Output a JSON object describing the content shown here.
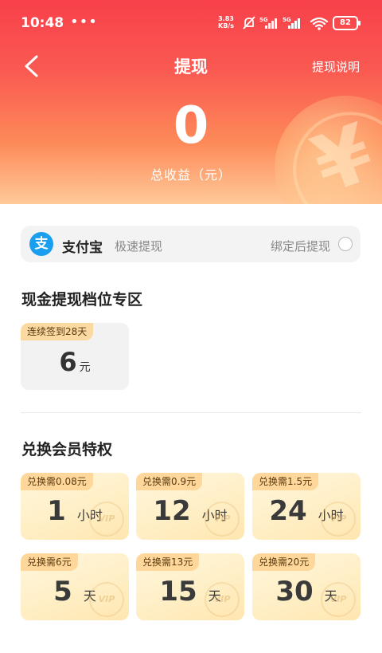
{
  "status_bar": {
    "time": "10:48",
    "more": "•••",
    "net_speed_value": "3.83",
    "net_speed_unit": "KB/s",
    "signal1_label": "5G",
    "signal2_label": "5G",
    "battery": "82"
  },
  "nav": {
    "title": "提现",
    "right_link": "提现说明"
  },
  "earnings": {
    "amount": "0",
    "label": "总收益（元）"
  },
  "alipay": {
    "logo_char": "支",
    "name": "支付宝",
    "subtitle": "极速提现",
    "bind_text": "绑定后提现"
  },
  "cash_section": {
    "title": "现金提现档位专区",
    "options": [
      {
        "tag": "连续签到28天",
        "value": "6",
        "unit": "元"
      }
    ]
  },
  "vip_section": {
    "title": "兑换会员特权",
    "watermark": "VIP",
    "options": [
      {
        "tag": "兑换需0.08元",
        "value": "1",
        "unit": "小时"
      },
      {
        "tag": "兑换需0.9元",
        "value": "12",
        "unit": "小时"
      },
      {
        "tag": "兑换需1.5元",
        "value": "24",
        "unit": "小时"
      },
      {
        "tag": "兑换需6元",
        "value": "5",
        "unit": "天"
      },
      {
        "tag": "兑换需13元",
        "value": "15",
        "unit": "天"
      },
      {
        "tag": "兑换需20元",
        "value": "30",
        "unit": "天"
      }
    ]
  },
  "colors": {
    "header_top": "#f8404a",
    "header_bottom": "#ffc99a",
    "alipay_blue": "#1a9ff0",
    "tag_bg": "#ffd79a",
    "vip_card_bg": "#fff2d0"
  },
  "icons": {
    "back": "back-arrow-icon",
    "coin": "yen-coin-icon",
    "radio": "radio-circle-icon"
  }
}
